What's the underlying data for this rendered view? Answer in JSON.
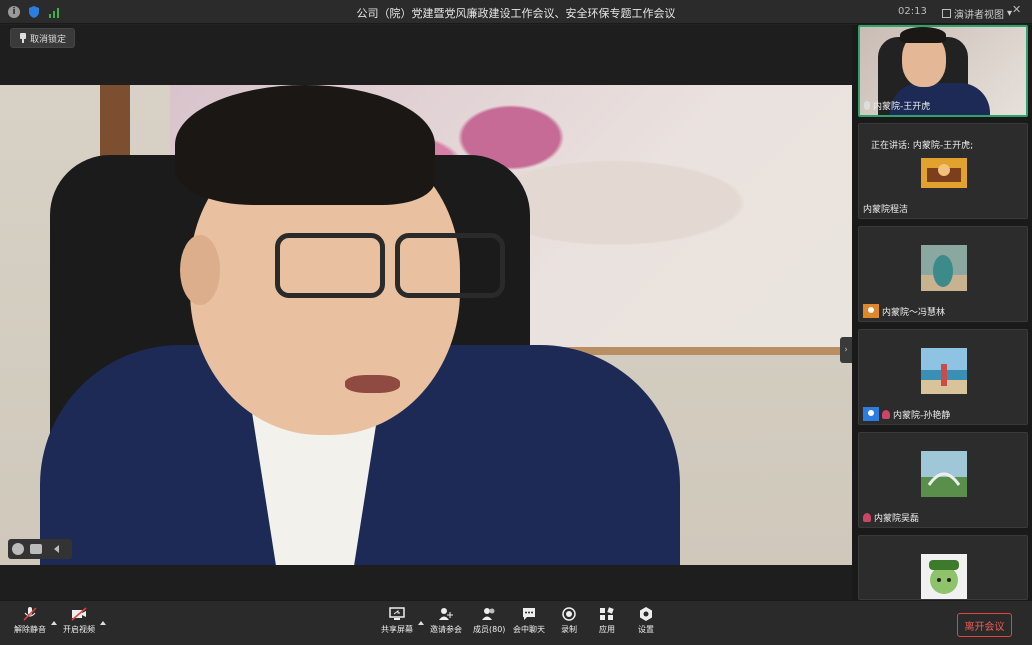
{
  "window": {
    "title": "公司（院）党建暨党风廉政建设工作会议、安全环保专题工作会议",
    "clock": "02:13",
    "view_mode": "演讲者视图",
    "view_mode_caret": "▾",
    "win_close": "✕"
  },
  "main": {
    "unlock_label": "取消锁定",
    "collapse_arrow": "›"
  },
  "sidebar": {
    "tiles": [
      {
        "name": "内蒙院-王开虎",
        "active": true
      },
      {
        "name": "内蒙院程洁",
        "speaking": "正在讲话: 内蒙院-王开虎;"
      },
      {
        "name": "内蒙院～冯慧林"
      },
      {
        "name": "内蒙院-孙艳静"
      },
      {
        "name": "内蒙院吴磊"
      },
      {
        "name": ""
      }
    ]
  },
  "toolbar": {
    "unmute": "解除静音",
    "start_video": "开启视频",
    "share_screen": "共享屏幕",
    "invite": "邀请参会",
    "members": "成员(80)",
    "chat": "会中聊天",
    "record": "录制",
    "apps": "应用",
    "settings": "设置",
    "leave": "离开会议"
  },
  "colors": {
    "accent_green": "#2fa36b",
    "leave_red": "#e2433f",
    "host_orange": "#e0862c",
    "host_blue": "#2b7de0"
  },
  "icons": {
    "info": "i"
  }
}
